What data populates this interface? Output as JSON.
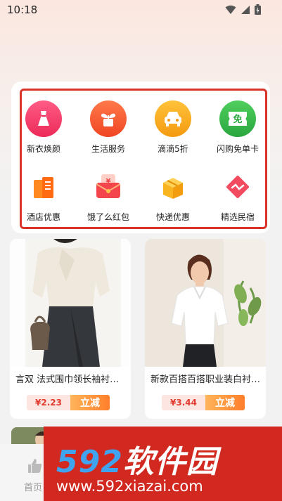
{
  "status_bar": {
    "time": "10:18"
  },
  "categories": [
    {
      "label": "新衣焕颜",
      "icon": "dress-icon",
      "color": "#f23c6b"
    },
    {
      "label": "生活服务",
      "icon": "plant-icon",
      "color": "#f5502f"
    },
    {
      "label": "滴滴5折",
      "icon": "car-icon",
      "color": "#f7a21b"
    },
    {
      "label": "闪购免单卡",
      "icon": "free-card-icon",
      "color": "#35b84a"
    },
    {
      "label": "酒店优惠",
      "icon": "hotel-icon",
      "color": "#ff7a1c"
    },
    {
      "label": "饿了么红包",
      "icon": "red-envelope-icon",
      "color": "#f4454d"
    },
    {
      "label": "快递优惠",
      "icon": "box-icon",
      "color": "#f8b51f"
    },
    {
      "label": "精选民宿",
      "icon": "homestay-icon",
      "color": "#f24a5e"
    }
  ],
  "products": [
    {
      "title": "言双 法式围巾领长袖衬衫女春秋季新款",
      "price": "¥2.23",
      "action": "立减"
    },
    {
      "title": "新款百搭百搭职业装白衬衫女短袖",
      "price": "¥3.44",
      "action": "立减"
    }
  ],
  "bottom_nav": {
    "home_label": "首页"
  },
  "watermark": {
    "title_num": "592",
    "title_text": "软件园",
    "url": "www.592xiazai.com"
  }
}
